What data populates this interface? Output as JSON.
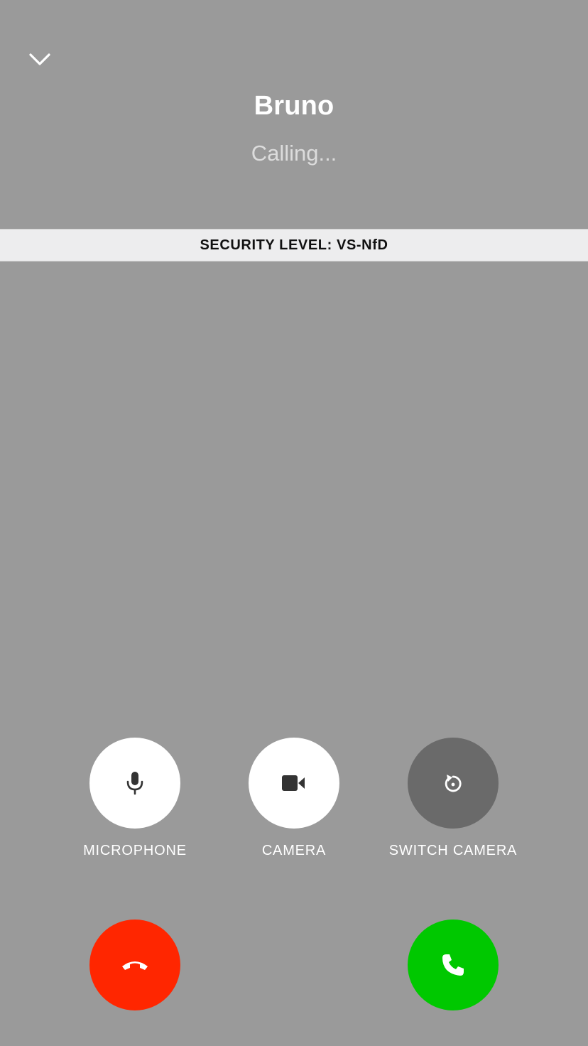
{
  "header": {
    "caller_name": "Bruno",
    "status": "Calling..."
  },
  "security": {
    "label": "SECURITY LEVEL: VS-NfD"
  },
  "controls": [
    {
      "label": "MICROPHONE",
      "icon": "microphone-icon",
      "state": "on"
    },
    {
      "label": "CAMERA",
      "icon": "video-camera-icon",
      "state": "on"
    },
    {
      "label": "SWITCH CAMERA",
      "icon": "switch-camera-icon",
      "state": "disabled"
    }
  ],
  "actions": {
    "decline_icon": "hang-up-icon",
    "accept_icon": "phone-icon"
  },
  "colors": {
    "background": "#9a9a9a",
    "decline": "#ff2600",
    "accept": "#00c800",
    "control_on": "#ffffff",
    "control_disabled": "#6a6a6a"
  }
}
